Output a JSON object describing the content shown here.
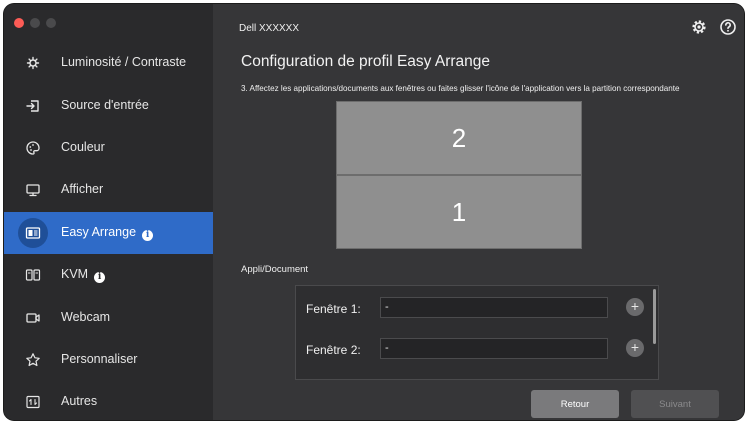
{
  "window": {
    "title": "Dell XXXXXX"
  },
  "sidebar": {
    "items": [
      {
        "label": "Luminosité / Contraste",
        "icon": "brightness-icon"
      },
      {
        "label": "Source d'entrée",
        "icon": "input-source-icon"
      },
      {
        "label": "Couleur",
        "icon": "color-palette-icon"
      },
      {
        "label": "Afficher",
        "icon": "display-monitor-icon"
      },
      {
        "label": "Easy Arrange",
        "icon": "easy-arrange-icon",
        "active": true,
        "info": true
      },
      {
        "label": "KVM",
        "icon": "kvm-icon",
        "info": true
      },
      {
        "label": "Webcam",
        "icon": "webcam-icon"
      },
      {
        "label": "Personnaliser",
        "icon": "star-icon"
      },
      {
        "label": "Autres",
        "icon": "others-icon"
      }
    ]
  },
  "main": {
    "page_title": "Configuration de profil Easy Arrange",
    "instruction": "3. Affectez les applications/documents aux fenêtres ou faites glisser l'icône de l'application vers la partition correspondante",
    "partitions": [
      {
        "number": "2"
      },
      {
        "number": "1"
      }
    ],
    "section_label": "Appli/Document",
    "windows": [
      {
        "label": "Fenêtre 1:",
        "value": "-"
      },
      {
        "label": "Fenêtre 2:",
        "value": "-"
      }
    ],
    "buttons": {
      "back": "Retour",
      "next": "Suivant"
    }
  },
  "colors": {
    "accent": "#2f6bc8",
    "sidebar_bg": "#2a2a2c",
    "main_bg": "#363638",
    "partition": "#8f8f8f"
  }
}
